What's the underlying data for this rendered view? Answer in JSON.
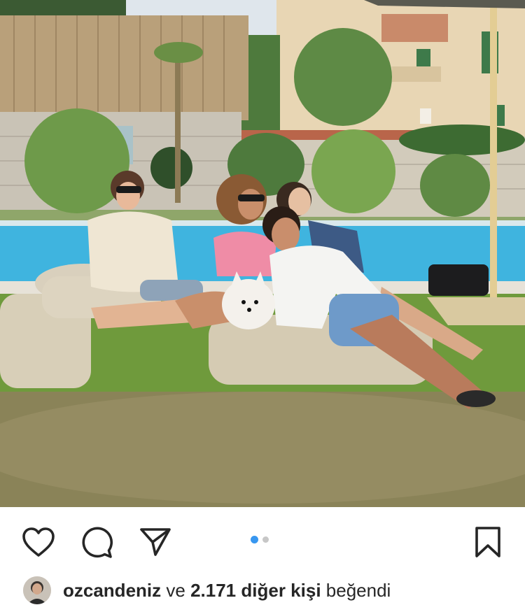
{
  "post": {
    "image_alt": "",
    "carousel": {
      "count": 2,
      "active_index": 0
    }
  },
  "actions": {
    "like_icon": "heart-icon",
    "comment_icon": "comment-icon",
    "share_icon": "send-icon",
    "save_icon": "bookmark-icon"
  },
  "likes": {
    "username": "ozcandeniz",
    "connector": "ve",
    "others_count": "2.171",
    "others_label": "diğer kişi",
    "suffix": "beğendi"
  },
  "colors": {
    "carousel_active": "#3897f0",
    "carousel_inactive": "#c7c7c7",
    "text": "#262626"
  }
}
